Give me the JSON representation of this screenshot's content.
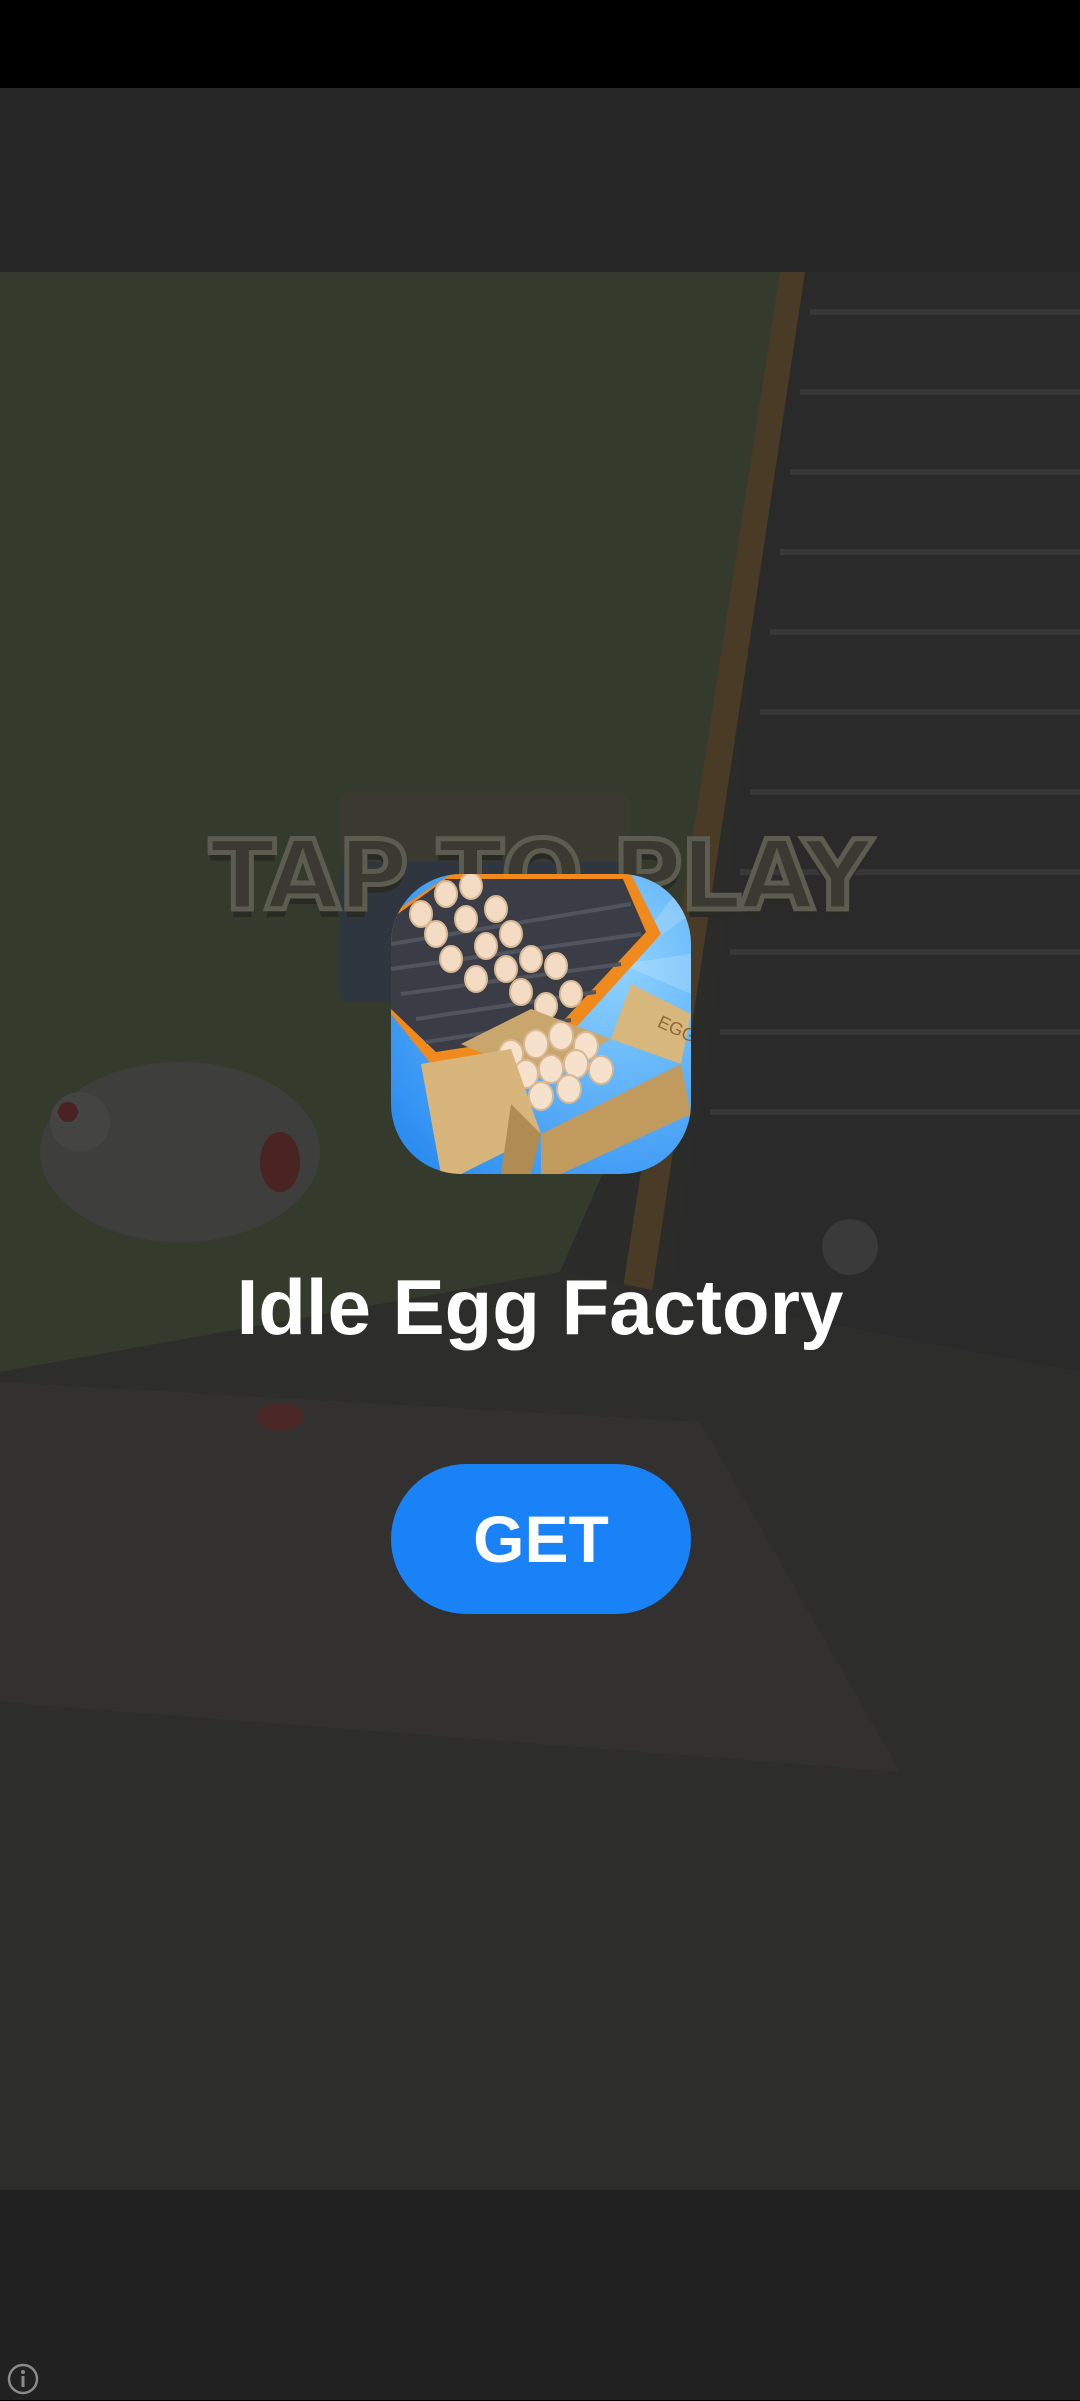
{
  "game_background": {
    "overlay_text": "TAP TO PLAY"
  },
  "ad": {
    "app_name": "Idle Egg Factory",
    "cta_label": "GET",
    "icon_name": "idle-egg-factory-app-icon",
    "box_label": "EGG"
  },
  "footer": {
    "info_icon": "info-icon"
  },
  "colors": {
    "cta_background": "#1a82f7",
    "title_text": "#ffffff",
    "scrim": "#262626"
  }
}
